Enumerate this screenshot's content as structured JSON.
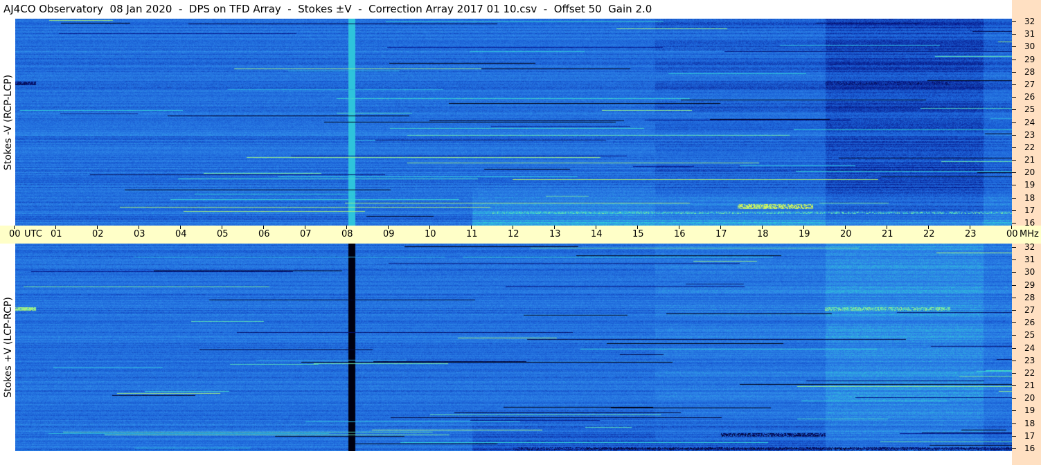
{
  "title": "AJ4CO Observatory  08 Jan 2020  -  DPS on TFD Array  -  Stokes ±V  -  Correction Array 2017 01 10.csv  -  Offset 50  Gain 2.0",
  "chart_data": [
    {
      "type": "heatmap",
      "panel": "top",
      "ylabel": "Stokes -V (RCP-LCP)",
      "x_unit": "UTC",
      "x_ticks": [
        "00",
        "01",
        "02",
        "03",
        "04",
        "05",
        "06",
        "07",
        "08",
        "09",
        "10",
        "11",
        "12",
        "13",
        "14",
        "15",
        "16",
        "17",
        "18",
        "19",
        "20",
        "21",
        "22",
        "23",
        "00"
      ],
      "y_unit": "MHz",
      "y_ticks": [
        "32",
        "31",
        "30",
        "29",
        "28",
        "27",
        "26",
        "25",
        "24",
        "23",
        "22",
        "21",
        "20",
        "19",
        "18",
        "17",
        "16"
      ],
      "ylim": [
        16,
        32
      ],
      "xlim_hours": [
        0,
        24
      ],
      "colormap": [
        "#000010",
        "#06188a",
        "#1a5fd6",
        "#2e86e8",
        "#2ed0d8",
        "#9cf08a",
        "#f7f23a",
        "#ff9a30",
        "#ff3020"
      ],
      "notable_features": [
        {
          "utc": 8.1,
          "note": "bright cyan vertical line"
        },
        {
          "mhz": 27,
          "utc_range": [
            0,
            0.5
          ],
          "note": "dark band"
        },
        {
          "mhz": 17.5,
          "utc_range": [
            17.5,
            19
          ],
          "note": "yellow/orange bursts"
        }
      ]
    },
    {
      "type": "heatmap",
      "panel": "bottom",
      "ylabel": "Stokes +V (LCP-RCP)",
      "x_unit": "UTC",
      "x_ticks": [
        "00",
        "01",
        "02",
        "03",
        "04",
        "05",
        "06",
        "07",
        "08",
        "09",
        "10",
        "11",
        "12",
        "13",
        "14",
        "15",
        "16",
        "17",
        "18",
        "19",
        "20",
        "21",
        "22",
        "23",
        "00"
      ],
      "y_unit": "MHz",
      "y_ticks": [
        "32",
        "31",
        "30",
        "29",
        "28",
        "27",
        "26",
        "25",
        "24",
        "23",
        "22",
        "21",
        "20",
        "19",
        "18",
        "17",
        "16"
      ],
      "ylim": [
        16,
        32
      ],
      "xlim_hours": [
        0,
        24
      ],
      "colormap": [
        "#000010",
        "#06188a",
        "#1a5fd6",
        "#2e86e8",
        "#2ed0d8",
        "#9cf08a",
        "#f7f23a",
        "#ff9a30",
        "#ff3020"
      ],
      "notable_features": [
        {
          "utc": 8.1,
          "note": "black vertical line"
        },
        {
          "mhz": 27,
          "utc_range": [
            0,
            0.5
          ],
          "note": "yellow band"
        },
        {
          "mhz": 27,
          "utc_range": [
            19.5,
            22.5
          ],
          "note": "yellow/green bursts"
        }
      ]
    }
  ],
  "time_axis": {
    "utc_label": "UTC",
    "mhz_label": "MHz",
    "labels": [
      "00",
      "01",
      "02",
      "03",
      "04",
      "05",
      "06",
      "07",
      "08",
      "09",
      "10",
      "11",
      "12",
      "13",
      "14",
      "15",
      "16",
      "17",
      "18",
      "19",
      "20",
      "21",
      "22",
      "23",
      "00"
    ]
  },
  "colors": {
    "axis_panel": "#ffe0c2",
    "time_bar": "#ffffc8",
    "background": "#2070dd"
  }
}
